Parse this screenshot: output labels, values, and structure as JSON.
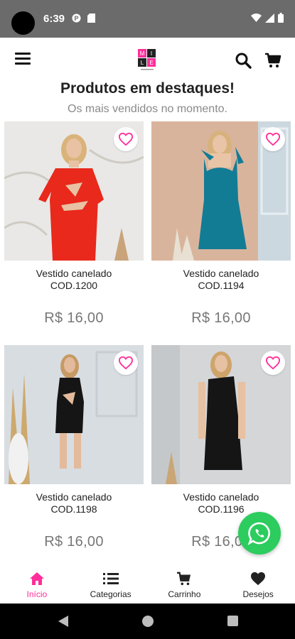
{
  "status": {
    "time": "6:39"
  },
  "header": {
    "logo": "MILE"
  },
  "section": {
    "title": "Produtos em destaques!",
    "subtitle": "Os mais vendidos no momento."
  },
  "products": [
    {
      "name": "Vestido canelado",
      "code": "COD.1200",
      "price": "R$  16,00",
      "dress_color": "#e8291b"
    },
    {
      "name": "Vestido canelado",
      "code": "COD.1194",
      "price": "R$  16,00",
      "dress_color": "#137c95"
    },
    {
      "name": "Vestido canelado",
      "code": "COD.1198",
      "price": "R$  16,00",
      "dress_color": "#151515"
    },
    {
      "name": "Vestido canelado",
      "code": "COD.1196",
      "price": "R$  16,00",
      "dress_color": "#151515"
    }
  ],
  "bottom_nav": [
    {
      "label": "Início",
      "icon": "home-icon",
      "active": true
    },
    {
      "label": "Categorias",
      "icon": "list-icon",
      "active": false
    },
    {
      "label": "Carrinho",
      "icon": "cart-icon",
      "active": false
    },
    {
      "label": "Desejos",
      "icon": "heart-icon",
      "active": false
    }
  ],
  "colors": {
    "accent": "#ff2e9a",
    "whatsapp": "#2ccc5f"
  }
}
